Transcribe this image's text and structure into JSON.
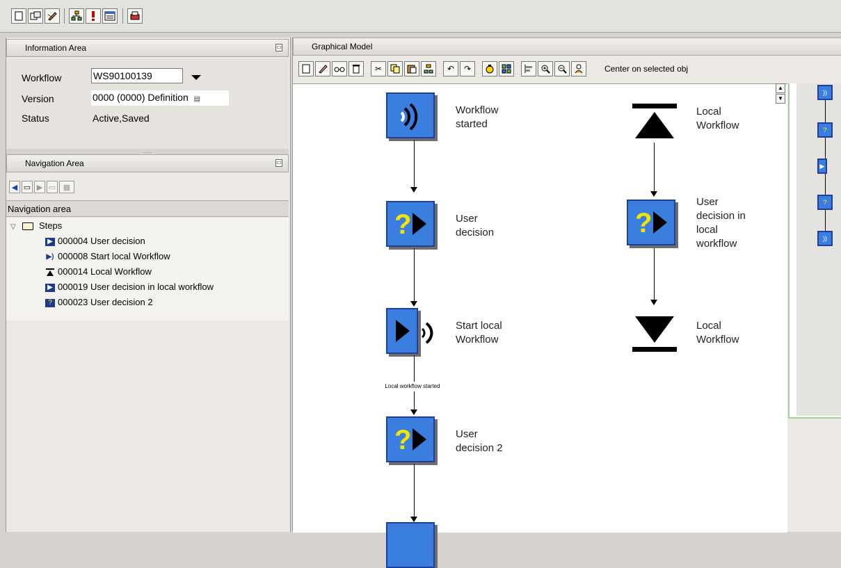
{
  "toolbar": {
    "buttons": [
      "new-document",
      "create-object",
      "edit-pen",
      "tree-structure",
      "exclamation",
      "display-window",
      "print"
    ]
  },
  "info_area": {
    "title": "Information Area",
    "workflow_label": "Workflow",
    "workflow_value": "WS90100139",
    "version_label": "Version",
    "version_value": "0000 (0000) Definition",
    "status_label": "Status",
    "status_value": "Active,Saved",
    "splitter_dots": "....."
  },
  "nav_area": {
    "title": "Navigation Area",
    "header": "Navigation area",
    "folder_label": "Steps",
    "items": [
      {
        "id": "000004",
        "text": "000004 User decision",
        "icon": "user-decision-icon"
      },
      {
        "id": "000008",
        "text": "000008 Start local Workflow",
        "icon": "start-local-workflow-icon"
      },
      {
        "id": "000014",
        "text": "000014 Local Workflow",
        "icon": "local-workflow-icon"
      },
      {
        "id": "000019",
        "text": "000019 User decision in local workflow",
        "icon": "user-decision-icon"
      },
      {
        "id": "000023",
        "text": "000023 User decision 2",
        "icon": "user-decision-icon"
      }
    ]
  },
  "graphical_model": {
    "title": "Graphical Model",
    "center_label": "Center on selected obj",
    "nodes": {
      "workflow_started": {
        "line1": "Workflow",
        "line2": "started"
      },
      "user_decision": {
        "line1": "User",
        "line2": "decision"
      },
      "start_local": {
        "line1": "Start local",
        "line2": "Workflow"
      },
      "user_decision_2": {
        "line1": "User",
        "line2": "decision 2"
      },
      "local_workflow_top": {
        "line1": "Local",
        "line2": "Workflow"
      },
      "user_decision_local": {
        "line1": "User",
        "line2": "decision in",
        "line3": "local",
        "line4": "workflow"
      },
      "local_workflow_bottom": {
        "line1": "Local",
        "line2": "Workflow"
      }
    },
    "edge_label": "Local workflow started"
  },
  "colors": {
    "node_fill": "#3a7fe0",
    "node_border": "#1f3f9f",
    "question_mark": "#f2e600",
    "minimap_border": "#9fd29f"
  }
}
